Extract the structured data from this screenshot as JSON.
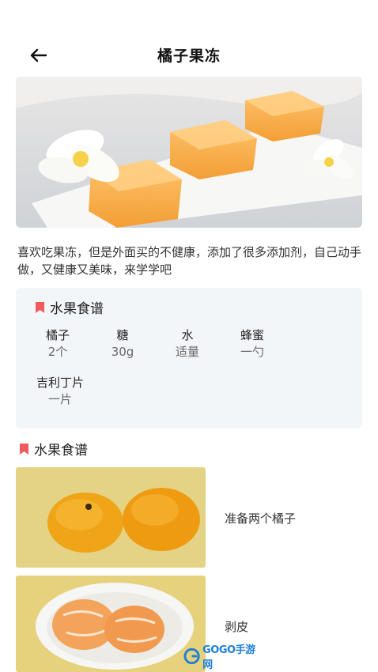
{
  "header": {
    "title": "橘子果冻"
  },
  "intro": "喜欢吃果冻，但是外面买的不健康，添加了很多添加剂，自己动手做，又健康又美味，来学学吧",
  "ingredients_card": {
    "title": "水果食谱",
    "items": [
      {
        "name": "橘子",
        "qty": "2个"
      },
      {
        "name": "糖",
        "qty": "30g"
      },
      {
        "name": "水",
        "qty": "适量"
      },
      {
        "name": "蜂蜜",
        "qty": "一勺"
      },
      {
        "name": "吉利丁片",
        "qty": "一片"
      }
    ]
  },
  "steps_section": {
    "title": "水果食谱",
    "steps": [
      {
        "text": "准备两个橘子"
      },
      {
        "text": "剥皮"
      }
    ]
  },
  "watermark": {
    "text": "GOGO手游网"
  },
  "colors": {
    "accent": "#f05a5a",
    "card_bg": "#f3f6f9",
    "watermark": "#1e7fd8"
  }
}
